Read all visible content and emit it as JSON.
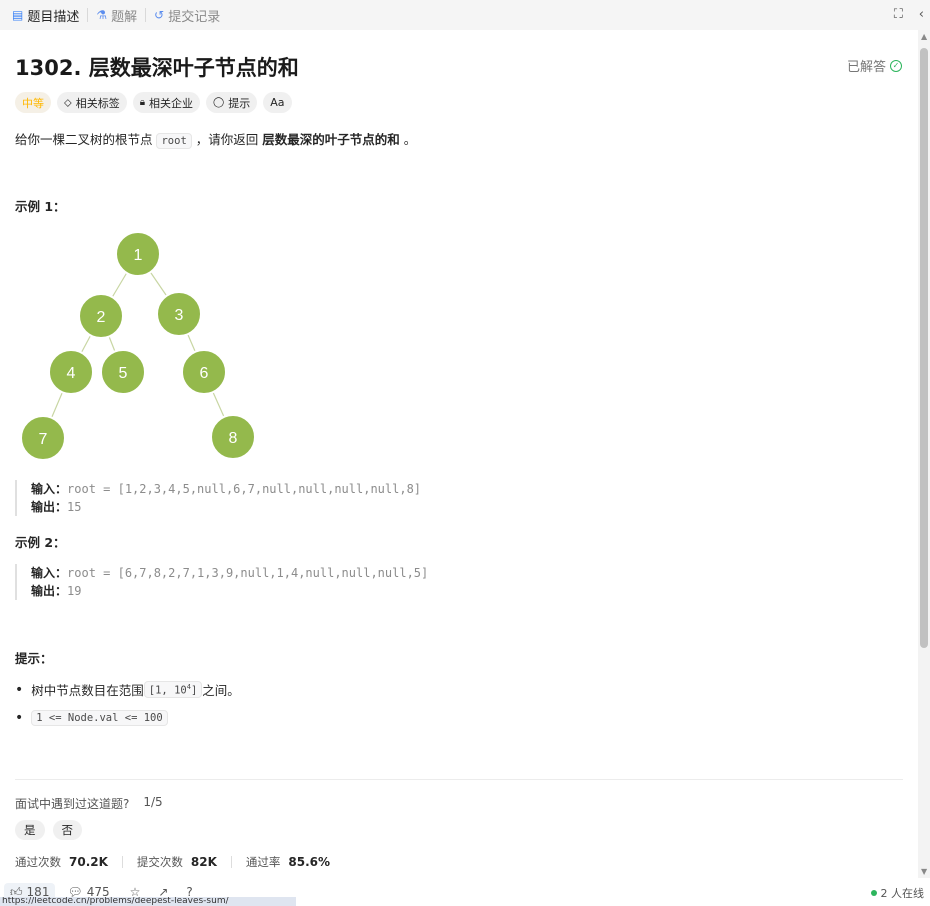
{
  "tabs": [
    {
      "label": "题目描述",
      "icon": "document-icon"
    },
    {
      "label": "题解",
      "icon": "flask-icon"
    },
    {
      "label": "提交记录",
      "icon": "history-icon"
    }
  ],
  "problem": {
    "title": "1302. 层数最深叶子节点的和",
    "status": "已解答",
    "difficulty": "中等",
    "tags": [
      "相关标签",
      "相关企业",
      "提示",
      "Aa"
    ],
    "desc_before": "给你一棵二叉树的根节点 ",
    "desc_code": "root",
    "desc_middle": " ，请你返回 ",
    "desc_bold": "层数最深的叶子节点的和",
    "desc_after": " 。"
  },
  "example1": {
    "heading": "示例 1：",
    "input_label": "输入：",
    "input_value": "root = [1,2,3,4,5,null,6,7,null,null,null,null,8]",
    "output_label": "输出：",
    "output_value": "15",
    "tree_nodes": [
      "1",
      "2",
      "3",
      "4",
      "5",
      "6",
      "7",
      "8"
    ]
  },
  "example2": {
    "heading": "示例 2：",
    "input_label": "输入：",
    "input_value": "root = [6,7,8,2,7,1,3,9,null,1,4,null,null,null,5]",
    "output_label": "输出：",
    "output_value": "19"
  },
  "constraints": {
    "heading": "提示：",
    "item1_before": "树中节点数目在范围 ",
    "item1_code": "[1, 10",
    "item1_sup": "4",
    "item1_code_end": "]",
    "item1_after": " 之间。",
    "item2_code": "1 <= Node.val <= 100"
  },
  "interview": {
    "question": "面试中遇到过这道题?",
    "page": "1/5",
    "yes": "是",
    "no": "否"
  },
  "stats": {
    "accepted_label": "通过次数",
    "accepted_value": "70.2K",
    "submissions_label": "提交次数",
    "submissions_value": "82K",
    "rate_label": "通过率",
    "rate_value": "85.6%"
  },
  "bottom": {
    "likes": "181",
    "comments": "475",
    "online": "2 人在线",
    "url": "https://leetcode.cn/problems/deepest-leaves-sum/"
  }
}
